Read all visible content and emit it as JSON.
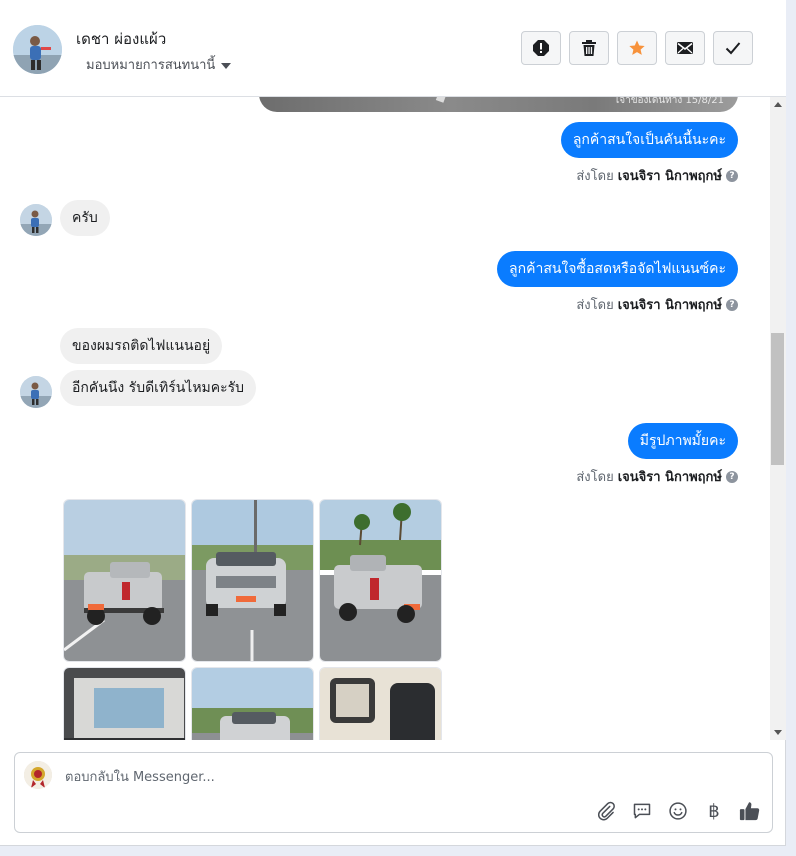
{
  "header": {
    "contact_name": "เดชา ผ่องแผ้ว",
    "assign_label": "มอบหมายการสนทนานี้",
    "actions": [
      {
        "name": "alert-icon"
      },
      {
        "name": "trash-icon"
      },
      {
        "name": "star-icon",
        "color": "#f7923b"
      },
      {
        "name": "envelope-icon"
      },
      {
        "name": "check-icon"
      }
    ]
  },
  "thread": {
    "top_image_caption": "เจ้าของเดินทาง 15/8/21",
    "messages": [
      {
        "dir": "out",
        "text": "ลูกค้าสนใจเป็นคันนี้นะคะ"
      },
      {
        "dir": "in",
        "text": "ครับ"
      },
      {
        "dir": "out",
        "text": "ลูกค้าสนใจซื้อสดหรือจัดไฟแนนซ์คะ"
      },
      {
        "dir": "in",
        "text": "ของผมรถติดไฟแนนอยู่"
      },
      {
        "dir": "in",
        "text": "อีกคันนึง รับดีเทิร์นไหมคะรับ"
      },
      {
        "dir": "out",
        "text": "มีรูปภาพมั้ยคะ"
      }
    ],
    "sent_by_prefix": "ส่งโดย",
    "sent_by_name": "เจนจิรา นิกาพฤกษ์",
    "sent_by_help": "?"
  },
  "composer": {
    "placeholder": "ตอบกลับใน Messenger...",
    "currency_symbol": "฿"
  },
  "colors": {
    "outgoing_bubble": "#0a7cff",
    "incoming_bubble": "#f0f0f0",
    "star_accent": "#f7923b"
  }
}
